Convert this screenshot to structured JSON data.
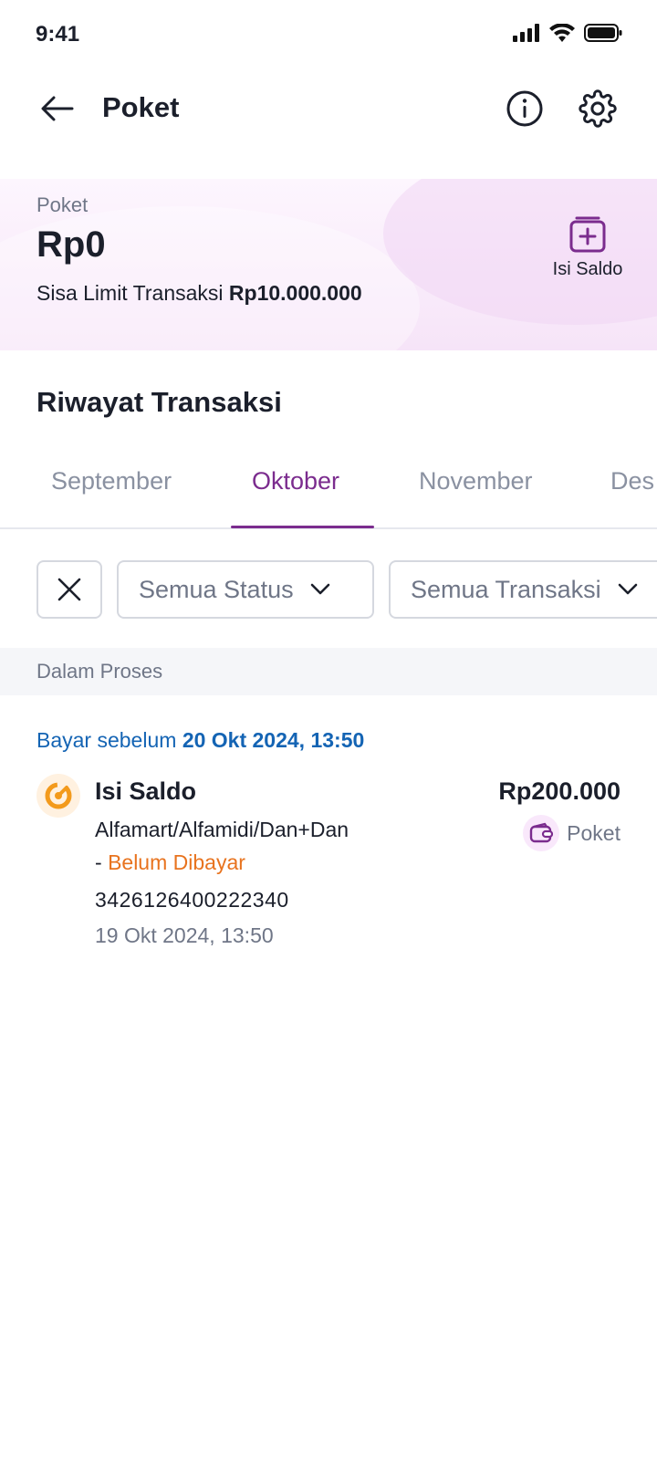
{
  "status_bar": {
    "time": "9:41"
  },
  "header": {
    "title": "Poket"
  },
  "balance": {
    "label": "Poket",
    "amount": "Rp0",
    "limit_prefix": "Sisa Limit Transaksi ",
    "limit_value": "Rp10.000.000",
    "topup_label": "Isi Saldo"
  },
  "history": {
    "title": "Riwayat Transaksi",
    "tabs": [
      {
        "label": "September"
      },
      {
        "label": "Oktober",
        "active": true
      },
      {
        "label": "November"
      },
      {
        "label": "Des"
      }
    ],
    "filters": {
      "status": "Semua Status",
      "type": "Semua Transaksi"
    },
    "group_label": "Dalam Proses",
    "transaction": {
      "due_prefix": "Bayar sebelum ",
      "due_date": "20 Okt 2024, 13:50",
      "title": "Isi Saldo",
      "amount": "Rp200.000",
      "merchant": "Alfamart/Alfamidi/Dan+Dan",
      "status_prefix": "- ",
      "status": "Belum Dibayar",
      "reference": "3426126400222340",
      "date": "19 Okt 2024, 13:50",
      "wallet": "Poket"
    }
  },
  "colors": {
    "accent": "#7b2c8e",
    "link_blue": "#1464b4",
    "pending_orange": "#e8731e"
  }
}
